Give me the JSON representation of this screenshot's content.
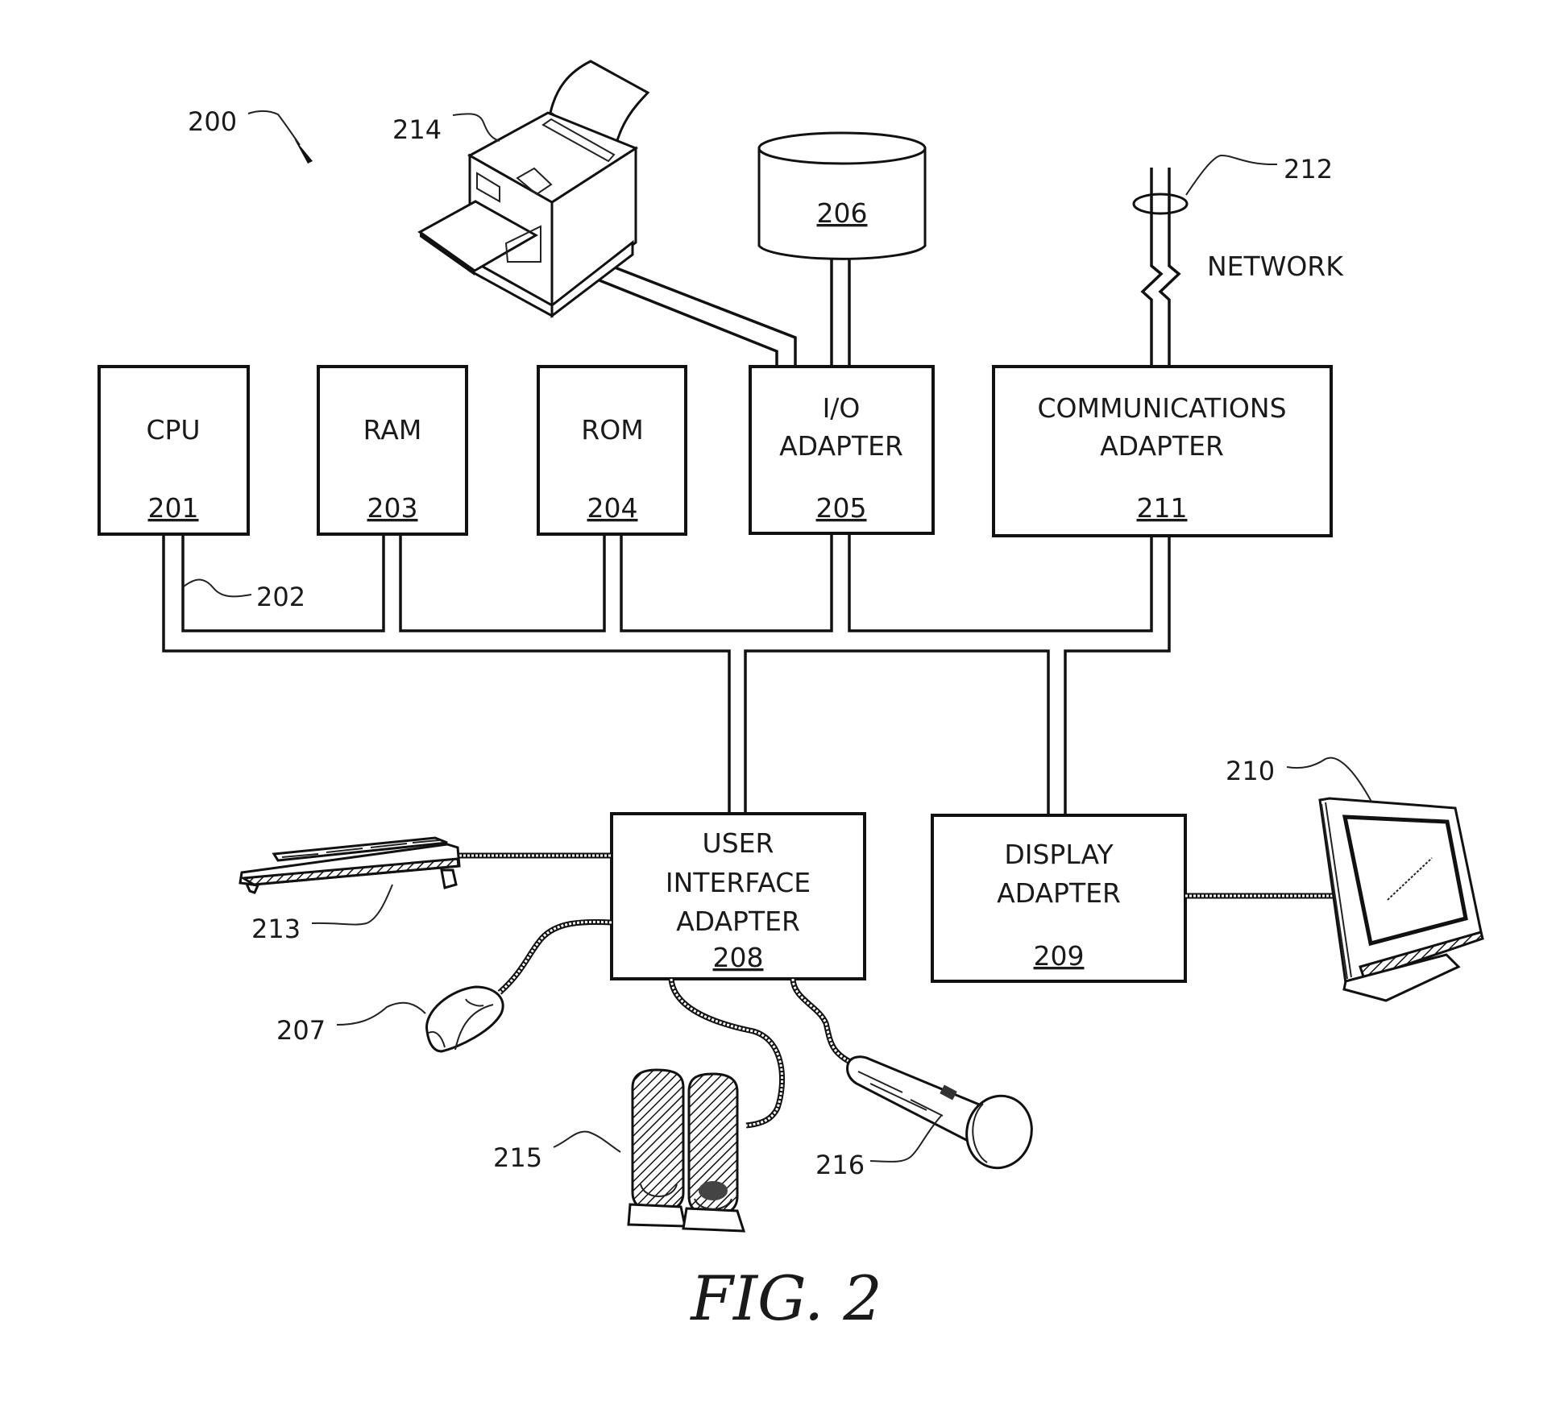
{
  "figure": {
    "caption": "FIG. 2",
    "system_ref": "200",
    "bus_ref": "202"
  },
  "components": {
    "cpu": {
      "label": "CPU",
      "ref": "201"
    },
    "ram": {
      "label": "RAM",
      "ref": "203"
    },
    "rom": {
      "label": "ROM",
      "ref": "204"
    },
    "io_adapter": {
      "label_line1": "I/O",
      "label_line2": "ADAPTER",
      "ref": "205"
    },
    "comm_adapter": {
      "label_line1": "COMMUNICATIONS",
      "label_line2": "ADAPTER",
      "ref": "211"
    },
    "ui_adapter": {
      "label_line1": "USER",
      "label_line2": "INTERFACE",
      "label_line3": "ADAPTER",
      "ref": "208"
    },
    "display_adapter": {
      "label_line1": "DISPLAY",
      "label_line2": "ADAPTER",
      "ref": "209"
    }
  },
  "peripherals": {
    "storage": {
      "ref": "206",
      "icon": "disk-cylinder-icon"
    },
    "printer": {
      "ref": "214",
      "icon": "printer-icon"
    },
    "network": {
      "ref": "212",
      "label": "NETWORK",
      "icon": "network-link-icon"
    },
    "keyboard": {
      "ref": "213",
      "icon": "keyboard-icon"
    },
    "mouse": {
      "ref": "207",
      "icon": "mouse-icon"
    },
    "speakers": {
      "ref": "215",
      "icon": "speakers-icon"
    },
    "microphone": {
      "ref": "216",
      "icon": "microphone-icon"
    },
    "display": {
      "ref": "210",
      "icon": "monitor-icon"
    }
  }
}
